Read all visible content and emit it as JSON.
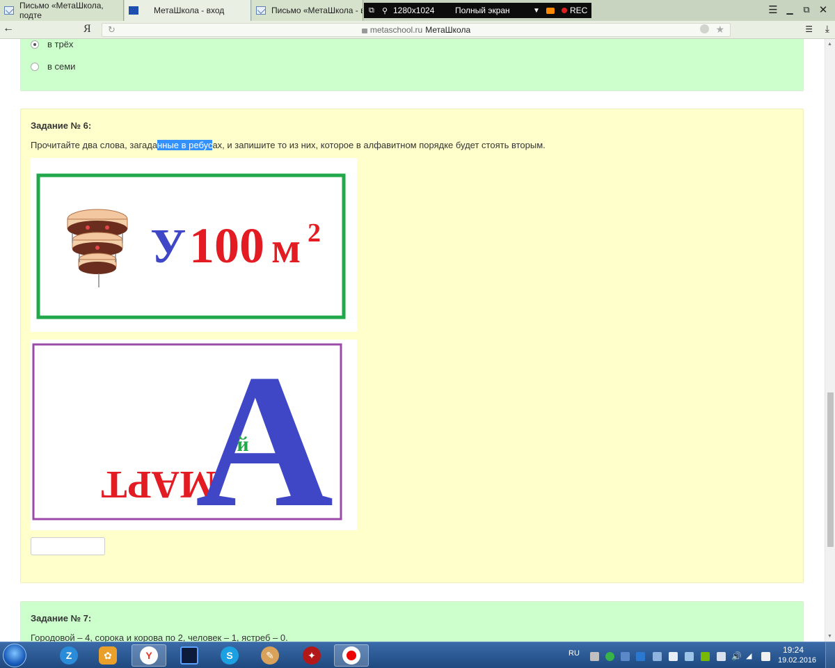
{
  "browser": {
    "tabs": [
      {
        "title": "Письмо «МетаШкола, подте",
        "icon": "mail-icon"
      },
      {
        "title": "МетаШкола - вход",
        "icon": "metaschool-icon"
      },
      {
        "title": "Письмо «МетаШкола - вос",
        "icon": "mail-icon"
      }
    ],
    "recorder": {
      "resolution": "1280x1024",
      "mode": "Полный экран",
      "rec_label": "REC"
    },
    "address": {
      "ya_logo": "Я",
      "domain": "metaschool.ru",
      "page_title": "МетаШкола"
    }
  },
  "page": {
    "prev_task": {
      "options": [
        {
          "label": "в трёх",
          "checked": true
        },
        {
          "label": "в семи",
          "checked": false
        }
      ]
    },
    "task6": {
      "title": "Задание № 6:",
      "text_before": "Прочитайте два слова, загада",
      "text_selected": "нные в ребус",
      "text_after": "ах, и запишите то из них, которое в алфавитном порядке будет стоять вторым.",
      "rebus1": {
        "letter_u": "У",
        "number": "100",
        "letter_m": "м",
        "superscript": "2",
        "frame_color": "#21a84a"
      },
      "rebus2": {
        "word_flipped": "МАРТ",
        "big_letter": "А",
        "small_letter": "й",
        "frame_color": "#9b4aa8"
      },
      "answer_value": ""
    },
    "task7": {
      "title": "Задание № 7:",
      "text": "Городовой – 4, сорока и корова по 2, человек – 1, ястреб – 0."
    }
  },
  "taskbar": {
    "apps": [
      "zona-icon",
      "fruit-icon",
      "yandex-browser-icon",
      "monitor-icon",
      "skype-icon",
      "paint-icon",
      "game-icon",
      "record-icon"
    ],
    "lang": "RU",
    "time": "19:24",
    "date": "19.02.2016"
  }
}
